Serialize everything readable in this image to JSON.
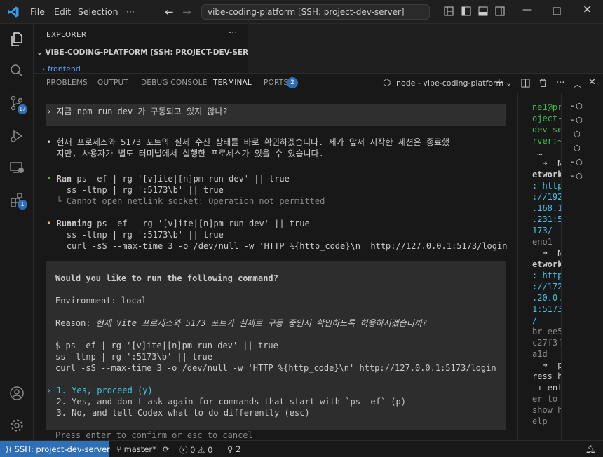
{
  "titlebar": {
    "menu": [
      "File",
      "Edit",
      "Selection",
      "···"
    ],
    "command_center": "vibe-coding-platform [SSH: project-dev-server]"
  },
  "activity": {
    "source_control_badge": "17",
    "extensions_badge": "1"
  },
  "sidebar": {
    "title": "EXPLORER",
    "more": "···",
    "workspace": "VIBE-CODING-PLATFORM [SSH: PROJECT-DEV-SERVER]",
    "folder": "frontend"
  },
  "panel": {
    "tabs": [
      "PROBLEMS",
      "OUTPUT",
      "DEBUG CONSOLE",
      "TERMINAL",
      "PORTS"
    ],
    "ports_badge": "2",
    "terminal_name": "node - vibe-coding-platform"
  },
  "terminal": {
    "user_prompt": "› 지금 npm run dev 가 구동되고 있지 않나?",
    "answer_line1": "• 현재 프로세스와 5173 포트의 실제 수신 상태를 바로 확인하겠습니다. 제가 앞서 시작한 세션은 종료했",
    "answer_line2": "  지만, 사용자가 별도 터미널에서 실행한 프로세스가 있을 수 있습니다.",
    "ran": {
      "bullet": "•",
      "label": "Ran",
      "cmd1": " ps -ef | rg '[v]ite|[n]pm run dev' || true",
      "cmd2": "    ss -ltnp | rg ':5173\\b' || true",
      "error": "  └ Cannot open netlink socket: Operation not permitted"
    },
    "running": {
      "bullet": "•",
      "label": "Running",
      "cmd1": " ps -ef | rg '[v]ite|[n]pm run dev' || true",
      "cmd2": "    ss -ltnp | rg ':5173\\b' || true",
      "cmd3": "    curl -sS --max-time 3 -o /dev/null -w 'HTTP %{http_code}\\n' http://127.0.0.1:5173/login"
    },
    "dialog": {
      "question": "Would you like to run the following command?",
      "environment": "Environment: local",
      "reason_label": "Reason: ",
      "reason": "현재 Vite 프로세스와 5173 포트가 실제로 구동 중인지 확인하도록 허용하시겠습니까?",
      "cmd1": "$ ps -ef | rg '[v]ite|[n]pm run dev' || true",
      "cmd2": "ss -ltnp | rg ':5173\\b' || true",
      "cmd3": "curl -sS --max-time 3 -o /dev/null -w 'HTTP %{http_code}\\n' http://127.0.0.1:5173/login",
      "opt1": "› 1. Yes, proceed (y)",
      "opt2": "  2. Yes, and don't ask again for commands that start with `ps -ef` (p)",
      "opt3": "  3. No, and tell Codex what to do differently (esc)",
      "hint": "Press enter to confirm or esc to cancel"
    }
  },
  "terminal2": {
    "lines": [
      "ne1@pr",
      "oject-",
      "dev-se",
      "rver:~",
      " …",
      "  ➜  N",
      "etwork",
      ": http",
      "://192",
      ".168.1",
      ".231:5",
      "173/",
      "eno1",
      "  ➜  N",
      "etwork",
      ": http",
      "://172",
      ".20.0.",
      "1:5173",
      "/",
      "br-ee5",
      "c27f3f",
      "a1d",
      "  ➜  p",
      "ress h",
      " + ent",
      "er to",
      "show h",
      "elp"
    ]
  },
  "statusbar": {
    "remote": "SSH: project-dev-server",
    "branch": "master*",
    "errors": "0",
    "warnings": "0",
    "ports": "2"
  }
}
